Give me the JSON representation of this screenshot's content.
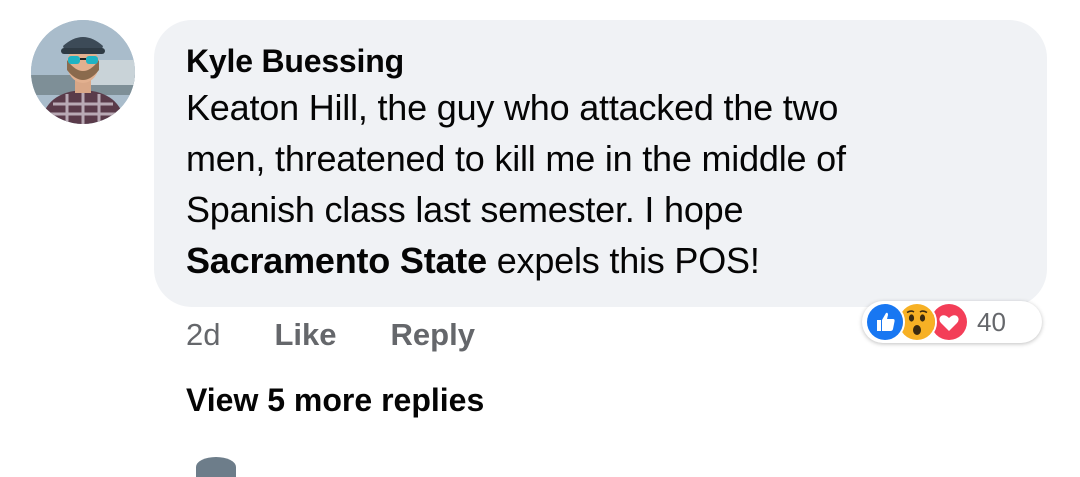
{
  "comment": {
    "author": "Kyle Buessing",
    "text_lines": [
      "Keaton Hill, the guy who attacked the two",
      "men, threatened to kill me in the middle of",
      "Spanish class last semester. I hope"
    ],
    "mention": "Sacramento State",
    "text_tail": " expels this POS!",
    "timestamp": "2d",
    "like_label": "Like",
    "reply_label": "Reply",
    "reactions": {
      "types": [
        "like-icon",
        "wow-icon",
        "love-icon"
      ],
      "count": "40",
      "colors": {
        "like": "#1877f2",
        "wow": "#f7b125",
        "love": "#f33e58"
      }
    }
  },
  "thread": {
    "view_more_label": "View 5 more replies"
  }
}
